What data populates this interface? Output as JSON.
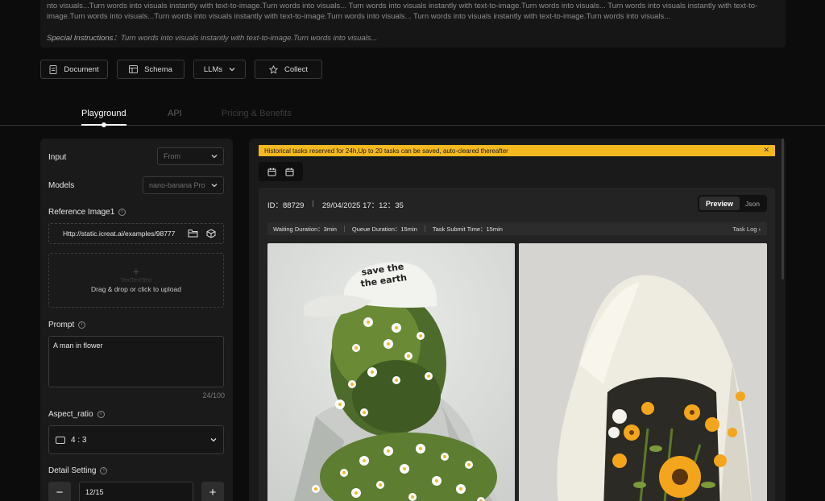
{
  "description": {
    "text": "nto visuals...Turn words into visuals instantly with text-to-image.Turn words into visuals... Turn words into visuals instantly with text-to-image.Turn words into visuals... Turn words into visuals instantly with text-to-image.Turn words into visuals...Turn words into visuals instantly with text-to-image.Turn words into visuals... Turn words into visuals instantly with text-to-image.Turn words into visuals...",
    "special_label": "Special Instructions：",
    "special_text": "Turn words into visuals instantly with text-to-image.Turn words into visuals..."
  },
  "actions": {
    "document": "Document",
    "schema": "Schema",
    "llms": "LLMs",
    "collect": "Collect"
  },
  "tabs": {
    "playground": "Playground",
    "api": "API",
    "pricing": "Pricing & Benefits"
  },
  "form": {
    "input_label": "Input",
    "input_value": "From",
    "models_label": "Models",
    "models_value": "nano-banana Pro",
    "ref_label": "Reference Image1",
    "ref_url": "Http://static.icreat.ai/examples/98777",
    "drop_sub": "TextTextText",
    "drop_text": "Drag & drop or click to upload",
    "prompt_label": "Prompt",
    "prompt_value": "A man in flower",
    "prompt_counter": "24/100",
    "aspect_label": "Aspect_ratio",
    "aspect_value": "4 : 3",
    "detail_label": "Detail Setting",
    "detail_value": "12/15",
    "minus": "−",
    "plus": "+"
  },
  "result": {
    "notice": "Historical tasks reserved for 24h,Up to 20 tasks can be saved, auto-cleared thereafter",
    "notice_close": "✕",
    "id_text": "ID：88729",
    "separator": "|",
    "datetime": "29/04/2025 17：12：35",
    "preview": "Preview",
    "json": "Json",
    "waiting": "Waiting Duration：3min",
    "queue": "Queue Duration：15min",
    "submit": "Task Submit Time：15min",
    "task_log": "Task Log ›"
  },
  "colors": {
    "accent_yellow": "#f5b920",
    "background": "#0c0c0c",
    "panel": "#1a1a1a"
  },
  "icons": {
    "document": "document-icon",
    "schema": "schema-icon",
    "collect": "star-icon",
    "folder": "folder-icon",
    "cube": "cube-icon",
    "calendar": "calendar-icon"
  }
}
